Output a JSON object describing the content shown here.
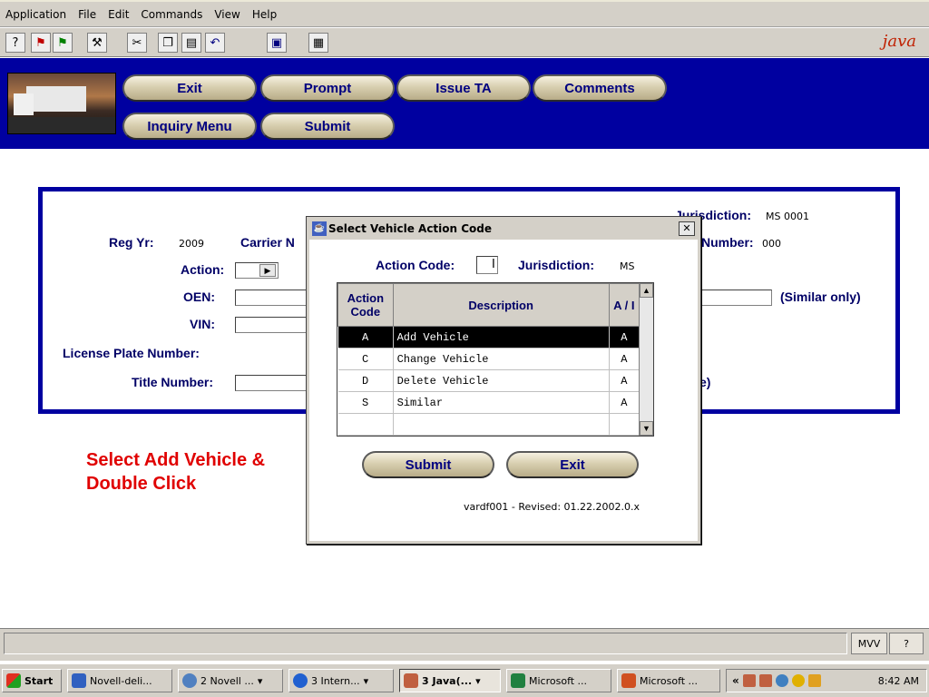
{
  "menu": [
    "Application",
    "File",
    "Edit",
    "Commands",
    "View",
    "Help"
  ],
  "toolbar_icons": [
    "help-icon",
    "flag-red-icon",
    "flag-green-icon",
    "tools-icon",
    "cut-icon",
    "copy-icon",
    "paste-icon",
    "undo-icon",
    "monitor-icon",
    "calculator-icon"
  ],
  "header": {
    "buttons": {
      "exit": "Exit",
      "prompt": "Prompt",
      "issue_ta": "Issue TA",
      "comments": "Comments",
      "inquiry_menu": "Inquiry Menu",
      "submit": "Submit"
    }
  },
  "form": {
    "reg_yr_label": "Reg Yr:",
    "reg_yr_value": "2009",
    "carrier_label": "Carrier N",
    "jurisdiction_label": "Jurisdiction:",
    "jurisdiction_value": "MS 0001",
    "number_label": "Number:",
    "number_value": "000",
    "action_label": "Action:",
    "oen_label": "OEN:",
    "vin_label": "VIN:",
    "similar_only": "(Similar only)",
    "license_plate_label": "License Plate Number:",
    "title_number_label": "Title Number:",
    "title_suffix": "e)"
  },
  "instruction": "Select  Add Vehicle & Double Click",
  "dialog": {
    "title": "Select Vehicle Action Code",
    "action_code_label": "Action Code:",
    "jurisdiction_label": "Jurisdiction:",
    "jurisdiction_value": "MS",
    "columns": {
      "code": "Action Code",
      "description": "Description",
      "ai": "A / I"
    },
    "rows": [
      {
        "code": "A",
        "description": "Add Vehicle",
        "ai": "A"
      },
      {
        "code": "C",
        "description": "Change Vehicle",
        "ai": "A"
      },
      {
        "code": "D",
        "description": "Delete Vehicle",
        "ai": "A"
      },
      {
        "code": "S",
        "description": "Similar",
        "ai": "A"
      }
    ],
    "submit_label": "Submit",
    "exit_label": "Exit",
    "revision": "vardf001 - Revised: 01.22.2002.0.x"
  },
  "statusbar": {
    "mvv": "MVV",
    "help": "?"
  },
  "taskbar": {
    "start": "Start",
    "items": [
      "Novell-deli...",
      "2 Novell ...",
      "3 Intern...",
      "3 Java(...",
      "Microsoft ...",
      "Microsoft ..."
    ],
    "clock": "8:42 AM"
  },
  "colors": {
    "header_blue": "#0000a0",
    "instruction_red": "#e00000",
    "label_navy": "#000066"
  }
}
